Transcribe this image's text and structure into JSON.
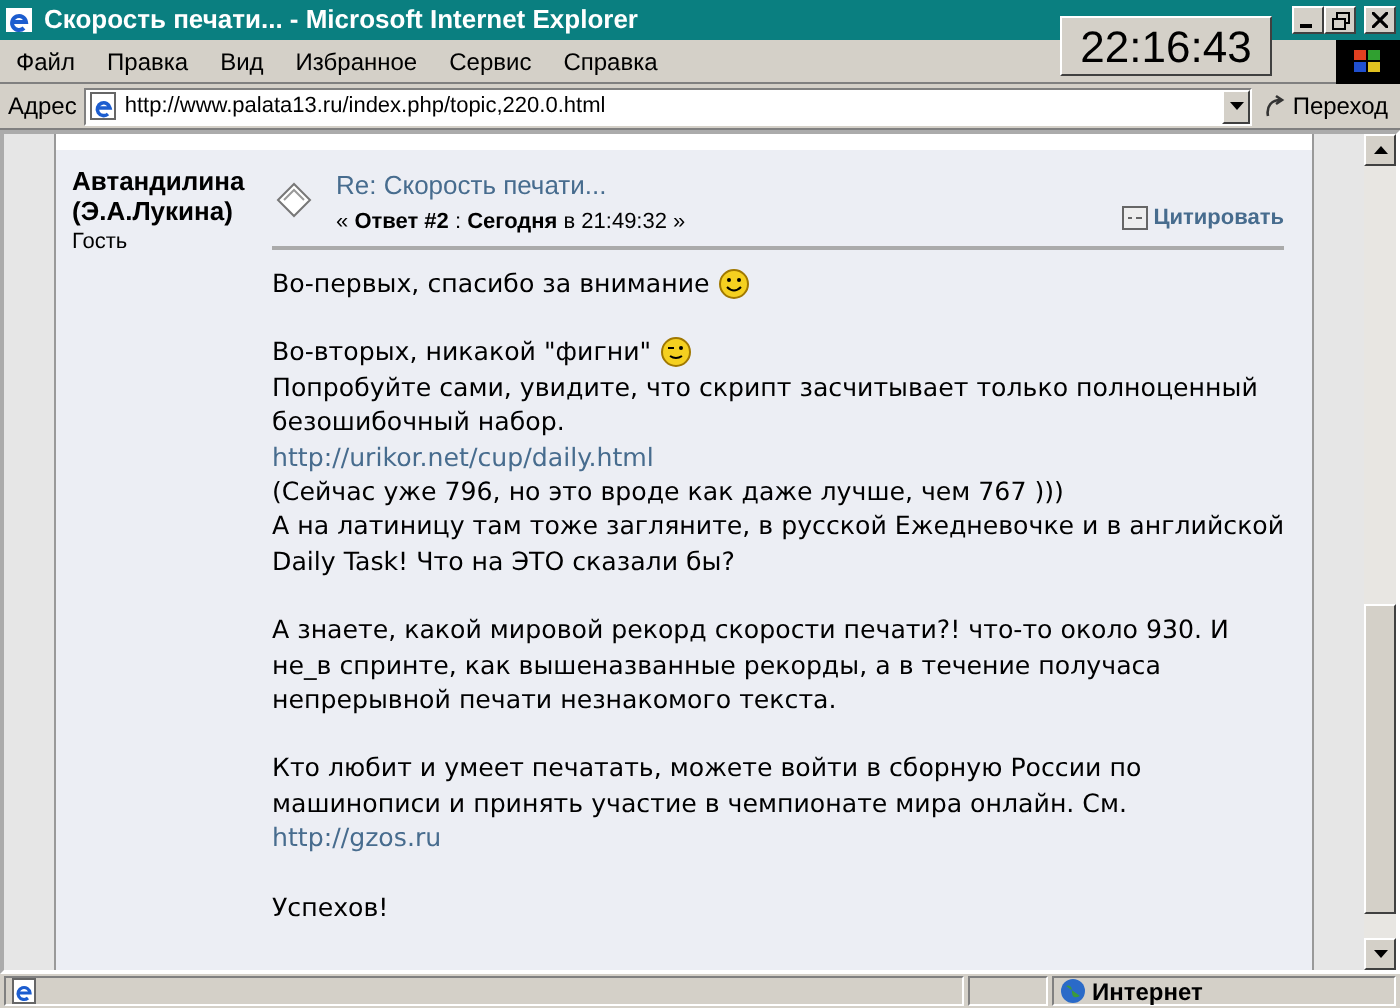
{
  "window": {
    "title": "Скорость печати... - Microsoft Internet Explorer"
  },
  "menu": [
    "Файл",
    "Правка",
    "Вид",
    "Избранное",
    "Сервис",
    "Справка"
  ],
  "clock": "22:16:43",
  "address_bar": {
    "label": "Адрес",
    "url": "http://www.palata13.ru/index.php/topic,220.0.html",
    "go_button": "Переход"
  },
  "post": {
    "author": "Автандилина (Э.А.Лукина)",
    "role": "Гость",
    "title": "Re: Скорость печати...",
    "meta": "« **Ответ #2** : **Сегодня** в 21:49:32 »",
    "quote_button": "Цитировать",
    "paragraphs": [
      [
        {
          "kind": "text",
          "text": "Во-первых, спасибо за внимание",
          "emoticon": {
            "kind": "smile"
          }
        }
      ],
      [
        {
          "kind": "text",
          "text": "Во-вторых, никакой \"фигни\"",
          "emoticon": {
            "kind": "wink"
          }
        },
        {
          "kind": "text",
          "text": "Попробуйте сами, увидите, что скрипт засчитывает только полноценный"
        },
        {
          "kind": "text",
          "text": "безошибочный набор."
        },
        {
          "kind": "link",
          "text": "http://urikor.net/cup/daily.html"
        },
        {
          "kind": "text",
          "text": "(Сейчас уже 796, но это вроде как даже лучше, чем 767 )))"
        },
        {
          "kind": "text",
          "text": "А на латиницу там тоже загляните, в русской Ежедневочке и в английской"
        },
        {
          "kind": "text",
          "text": "Daily Task! Что на ЭТО сказали бы?"
        }
      ],
      [
        {
          "kind": "text",
          "text": "А знаете, какой мировой рекорд скорости печати?! что-то около 930. И"
        },
        {
          "kind": "text",
          "text": "не_в спринте, как вышеназванные рекорды, а в течение получаса"
        },
        {
          "kind": "text",
          "text": "непрерывной печати незнакомого текста."
        }
      ],
      [
        {
          "kind": "text",
          "text": "Кто любит и умеет печатать, можете войти в сборную России по"
        },
        {
          "kind": "text",
          "text": "машинописи и принять участие в чемпионате мира онлайн. См."
        },
        {
          "kind": "link",
          "text": "http://gzos.ru"
        }
      ],
      [
        {
          "kind": "text",
          "text": "Успехов!"
        }
      ]
    ]
  },
  "status_bar": {
    "zone": "Интернет"
  }
}
